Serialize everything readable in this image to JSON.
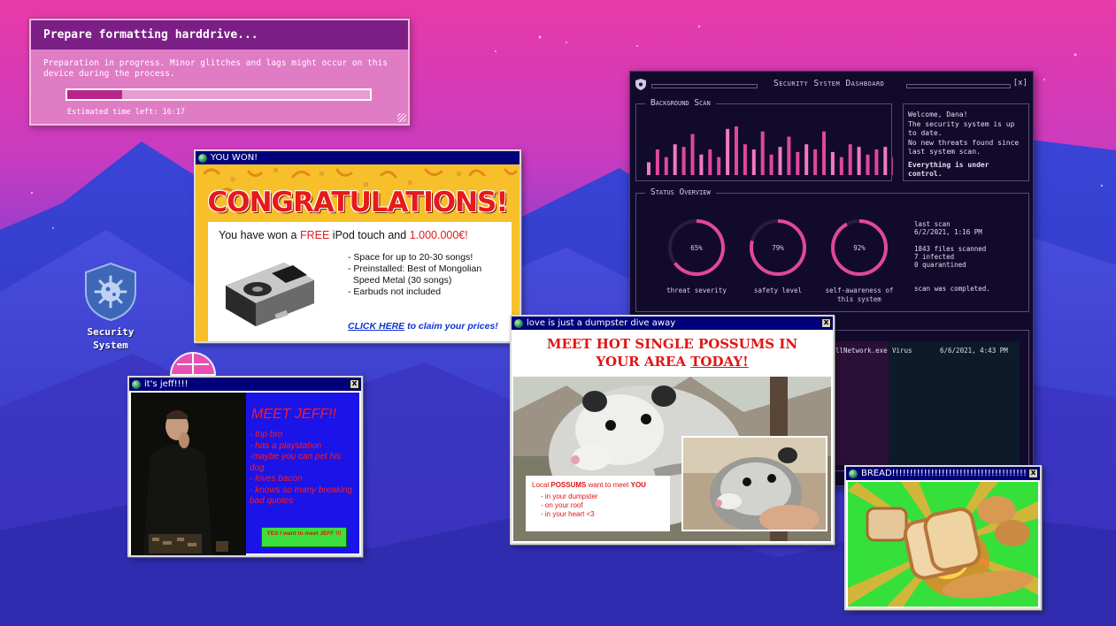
{
  "format_window": {
    "title": "Prepare formatting harddrive...",
    "message": "Preparation in progress. Minor glitches and lags might occur on this device during the process.",
    "progress": 0.18,
    "eta": "Estimated time left: 16:17"
  },
  "desktop_icon": {
    "label_line1": "Security",
    "label_line2": "System",
    "icon": "shield-virus-icon"
  },
  "won_window": {
    "title": "YOU WON!",
    "headline": "CONGRATULATIONS!",
    "line_pre": "You have won a ",
    "line_free": "FREE",
    "line_mid": " iPod touch and ",
    "line_amount": "1.000.000€!",
    "features": [
      "- Space for up to 20-30 songs!",
      "- Preinstalled: Best of Mongolian",
      "  Speed Metal (30 songs)",
      "- Earbuds not included"
    ],
    "cta_link": "CLICK HERE",
    "cta_rest": " to claim your prices!"
  },
  "dashboard": {
    "title": "Security System Dashboard",
    "close": "[x]",
    "scan_panel_title": "Background Scan",
    "scan_bars": [
      0.25,
      0.5,
      0.35,
      0.6,
      0.55,
      0.8,
      0.4,
      0.5,
      0.35,
      0.9,
      0.95,
      0.6,
      0.5,
      0.85,
      0.4,
      0.55,
      0.75,
      0.45,
      0.6,
      0.5,
      0.85,
      0.45,
      0.35,
      0.6,
      0.55,
      0.4,
      0.5,
      0.55,
      0.35,
      0.6
    ],
    "welcome": "Welcome, Dana!",
    "msg1": "The security system is up to date.",
    "msg2": "No new threats found since last system scan.",
    "msg3": "Everything is under control.",
    "status_panel_title": "Status Overview",
    "gauges": [
      {
        "value": 65,
        "label": "65%",
        "caption": "threat severity"
      },
      {
        "value": 79,
        "label": "79%",
        "caption": "safety level"
      },
      {
        "value": 92,
        "label": "92%",
        "caption": "self-awareness of this system"
      }
    ],
    "last_scan_label": "last scan",
    "last_scan_date": "6/2/2021, 1:16 PM",
    "files_scanned": "1843 files scanned",
    "infected": "7 infected",
    "quarantined": "0 quarantined",
    "scan_complete": "scan was completed.",
    "virus_row": {
      "file": "llNetwork.exe",
      "type": "Virus",
      "date": "6/6/2021, 4:43 PM"
    },
    "accent": "#e0479e"
  },
  "possum_window": {
    "title": "love is just a dumpster dive away",
    "headline_1": "MEET HOT SINGLE POSSUMS IN",
    "headline_2a": "YOUR AREA ",
    "headline_2b": "TODAY!",
    "card_pre": "Local ",
    "card_bold1": "POSSUMS",
    "card_mid": " want to meet ",
    "card_bold2": "YOU",
    "card_items": [
      "- in your dumpster",
      "- on your roof",
      "- in your heart <3"
    ]
  },
  "jeff_window": {
    "title": "it's jeff!!!!",
    "headline": "MEET JEFF!!",
    "traits": [
      "- top bro",
      "- has a playstation",
      "-maybe you can pet his dog",
      "- loves bacon",
      "- knows so many breaking bad quotes"
    ],
    "button": "YES I want to meet JEFF !!!"
  },
  "bread_window": {
    "title": "BREAD!!!!!!!!!!!!!!!!!!!!!!!!!!!!!!!!!!!!!!"
  }
}
